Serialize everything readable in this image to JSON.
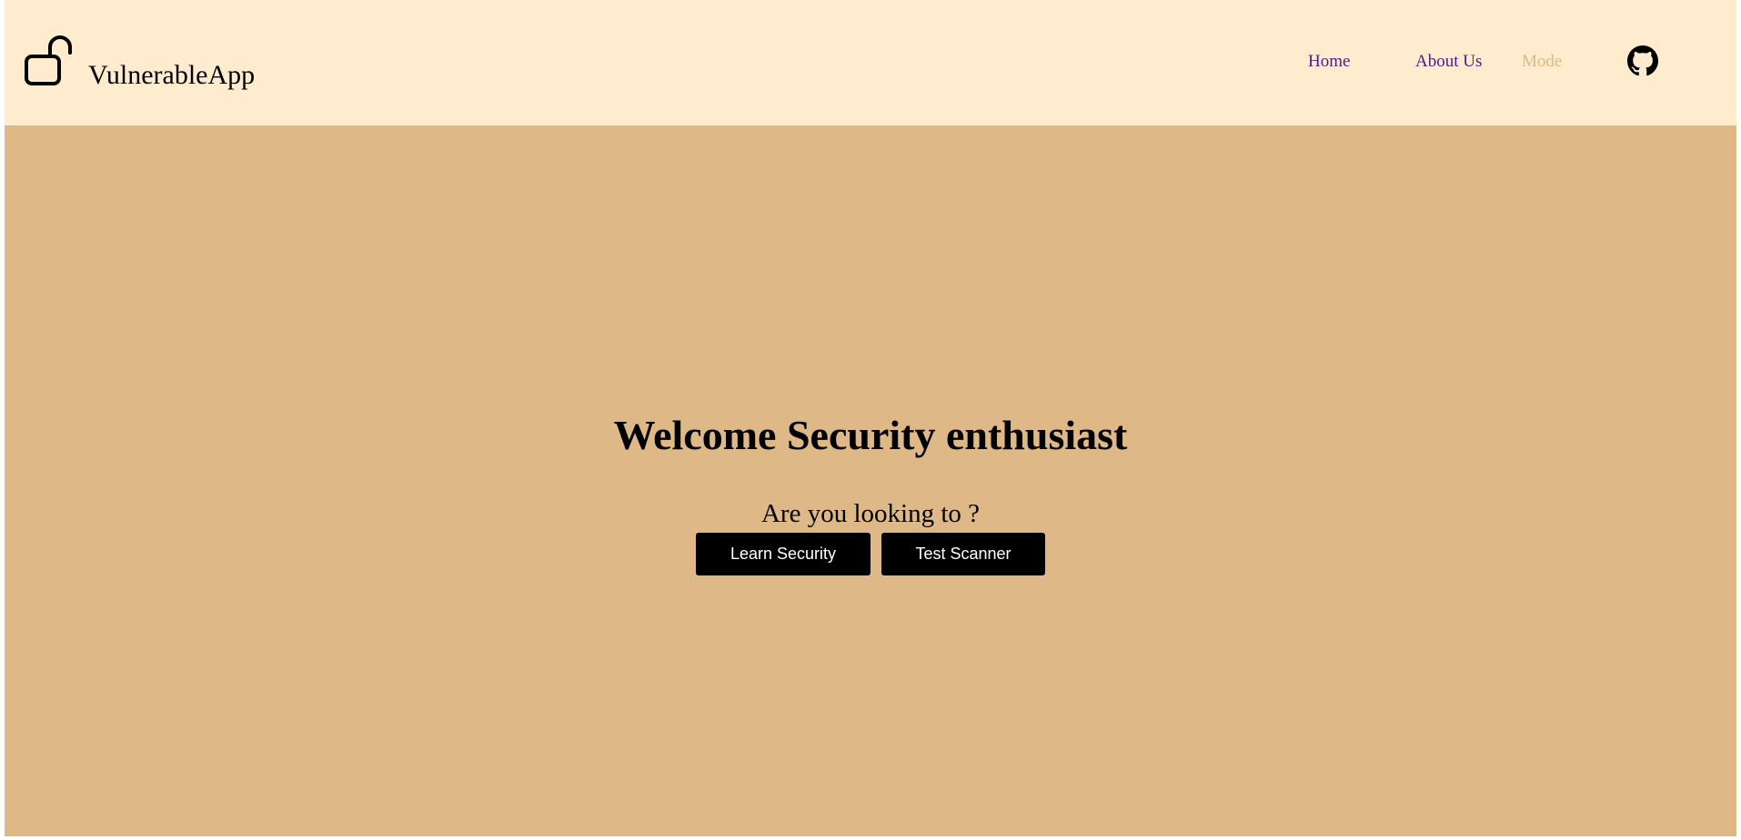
{
  "theme": {
    "header_bg": "#ffebcd",
    "hero_bg": "#deb887",
    "nav_link_color": "#4b1c8c",
    "mode_link_color": "#deb887",
    "button_bg": "#000000",
    "button_text": "#ffffff"
  },
  "header": {
    "logo_icon": "unlocked-padlock-icon",
    "app_name": "VulnerableApp",
    "nav": {
      "home": "Home",
      "about": "About Us",
      "mode": "Mode"
    },
    "github_icon": "github-icon"
  },
  "hero": {
    "title": "Welcome Security enthusiast",
    "question": "Are you looking to ?",
    "buttons": {
      "learn": "Learn Security",
      "scanner": "Test Scanner"
    }
  }
}
